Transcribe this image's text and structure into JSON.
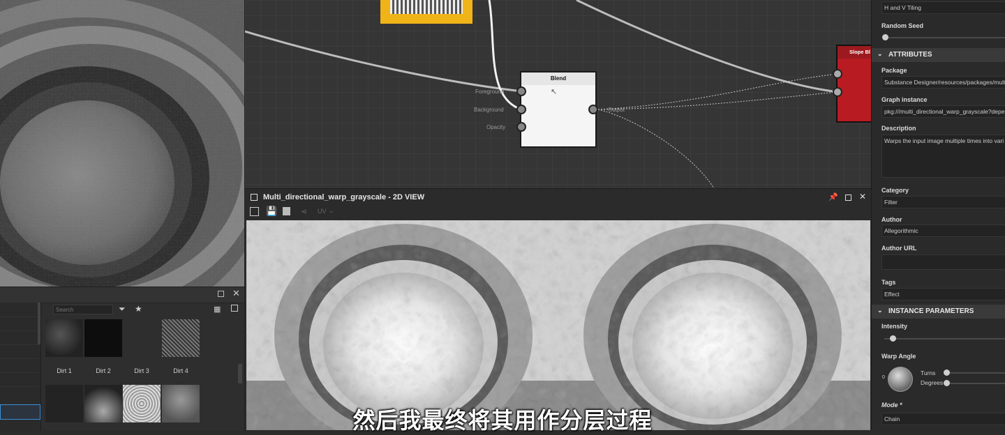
{
  "graph": {
    "blend_node": {
      "title": "Blend",
      "inputs": [
        "Foreground",
        "Background",
        "Opacity"
      ],
      "output": "Output"
    },
    "slope_node_title": "Slope Bl"
  },
  "view2d": {
    "title": "Multi_directional_warp_grayscale - 2D VIEW",
    "uv_label": "UV"
  },
  "library": {
    "search_placeholder": "Search",
    "row1": [
      "Dirt 1",
      "Dirt 2",
      "Dirt 3",
      "Dirt 4"
    ]
  },
  "properties": {
    "tiling_value": "H and V Tiling",
    "random_seed_label": "Random Seed",
    "attributes_header": "ATTRIBUTES",
    "package_label": "Package",
    "package_value": "Substance Designer/resources/packages/multi_",
    "graph_instance_label": "Graph instance",
    "graph_instance_value": "pkg:///multi_directional_warp_grayscale?depen",
    "description_label": "Description",
    "description_value": "Warps the input image multiple times into vari",
    "category_label": "Category",
    "category_value": "Filter",
    "author_label": "Author",
    "author_value": "Allegorithmic",
    "author_url_label": "Author URL",
    "author_url_value": "",
    "tags_label": "Tags",
    "tags_value": "Effect",
    "instance_header": "INSTANCE PARAMETERS",
    "intensity_label": "Intensity",
    "warp_angle_label": "Warp Angle",
    "dial_zero": "0",
    "turns_label": "Turns",
    "degrees_label": "Degrees",
    "mode_label": "Mode *",
    "mode_value": "Chain"
  },
  "subtitle": "然后我最终将其用作分层过程",
  "colors": {
    "slope_node": "#b81b22",
    "selected_node_border": "#f0b419",
    "panel_bg": "#2a2a2a"
  }
}
